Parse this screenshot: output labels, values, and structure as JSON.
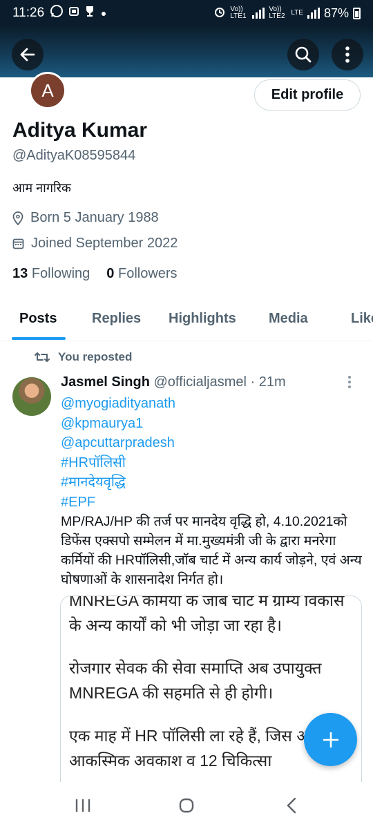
{
  "status_bar": {
    "time": "11:26",
    "sim1_label": "Vo)) LTE1",
    "sim2_label": "Vo)) LTE2",
    "network": "LTE",
    "battery": "87%"
  },
  "header": {
    "back_icon": "arrow-left-icon",
    "search_icon": "search-icon",
    "more_icon": "more-vertical-icon"
  },
  "profile": {
    "avatar_letter": "A",
    "edit_label": "Edit profile",
    "name": "Aditya Kumar",
    "handle": "@AdityaK08595844",
    "bio": "आम नागरिक",
    "born": "Born 5 January 1988",
    "joined": "Joined September 2022",
    "following_count": "13",
    "following_label": "Following",
    "followers_count": "0",
    "followers_label": "Followers"
  },
  "tabs": [
    "Posts",
    "Replies",
    "Highlights",
    "Media",
    "Likes"
  ],
  "post": {
    "repost_label": "You reposted",
    "author": "Jasmel Singh",
    "author_handle": "@officialjasmel",
    "time": "· 21m",
    "mentions": [
      "@myogiadityanath",
      "@kpmaurya1",
      "@apcuttarpradesh"
    ],
    "hashtags": [
      "#HRपॉलिसी",
      "#मानदेयवृद्धि",
      "#EPF"
    ],
    "text": "MP/RAJ/HP की तर्ज पर मानदेय वृद्धि हो, 4.10.2021को डिफेंस एक्सपो सम्मेलन में मा.मुख्यमंत्री जी के द्वारा मनरेगा कर्मियों की HRपॉलिसी,जॉब चार्ट में अन्य कार्य जोड़ने, एवं अन्य घोषणाओं के शासनादेश निर्गत हो।",
    "image_paragraphs": [
      "MNREGA कामया क जाब चाट म ग्राम्य विकास के अन्य कार्यों को भी जोड़ा जा रहा है।",
      "रोजगार सेवक की सेवा समाप्ति अब उपायुक्त MNREGA की सहमति से ही होगी।",
      "एक माह में HR पॉलिसी ला रहे हैं, जिस अब 24 आकस्मिक अवकाश व 12 चिकित्सा"
    ]
  },
  "colors": {
    "accent": "#1d9bf0",
    "text": "#0f1419",
    "muted": "#536471",
    "header_bg": "#0b1d2c"
  }
}
